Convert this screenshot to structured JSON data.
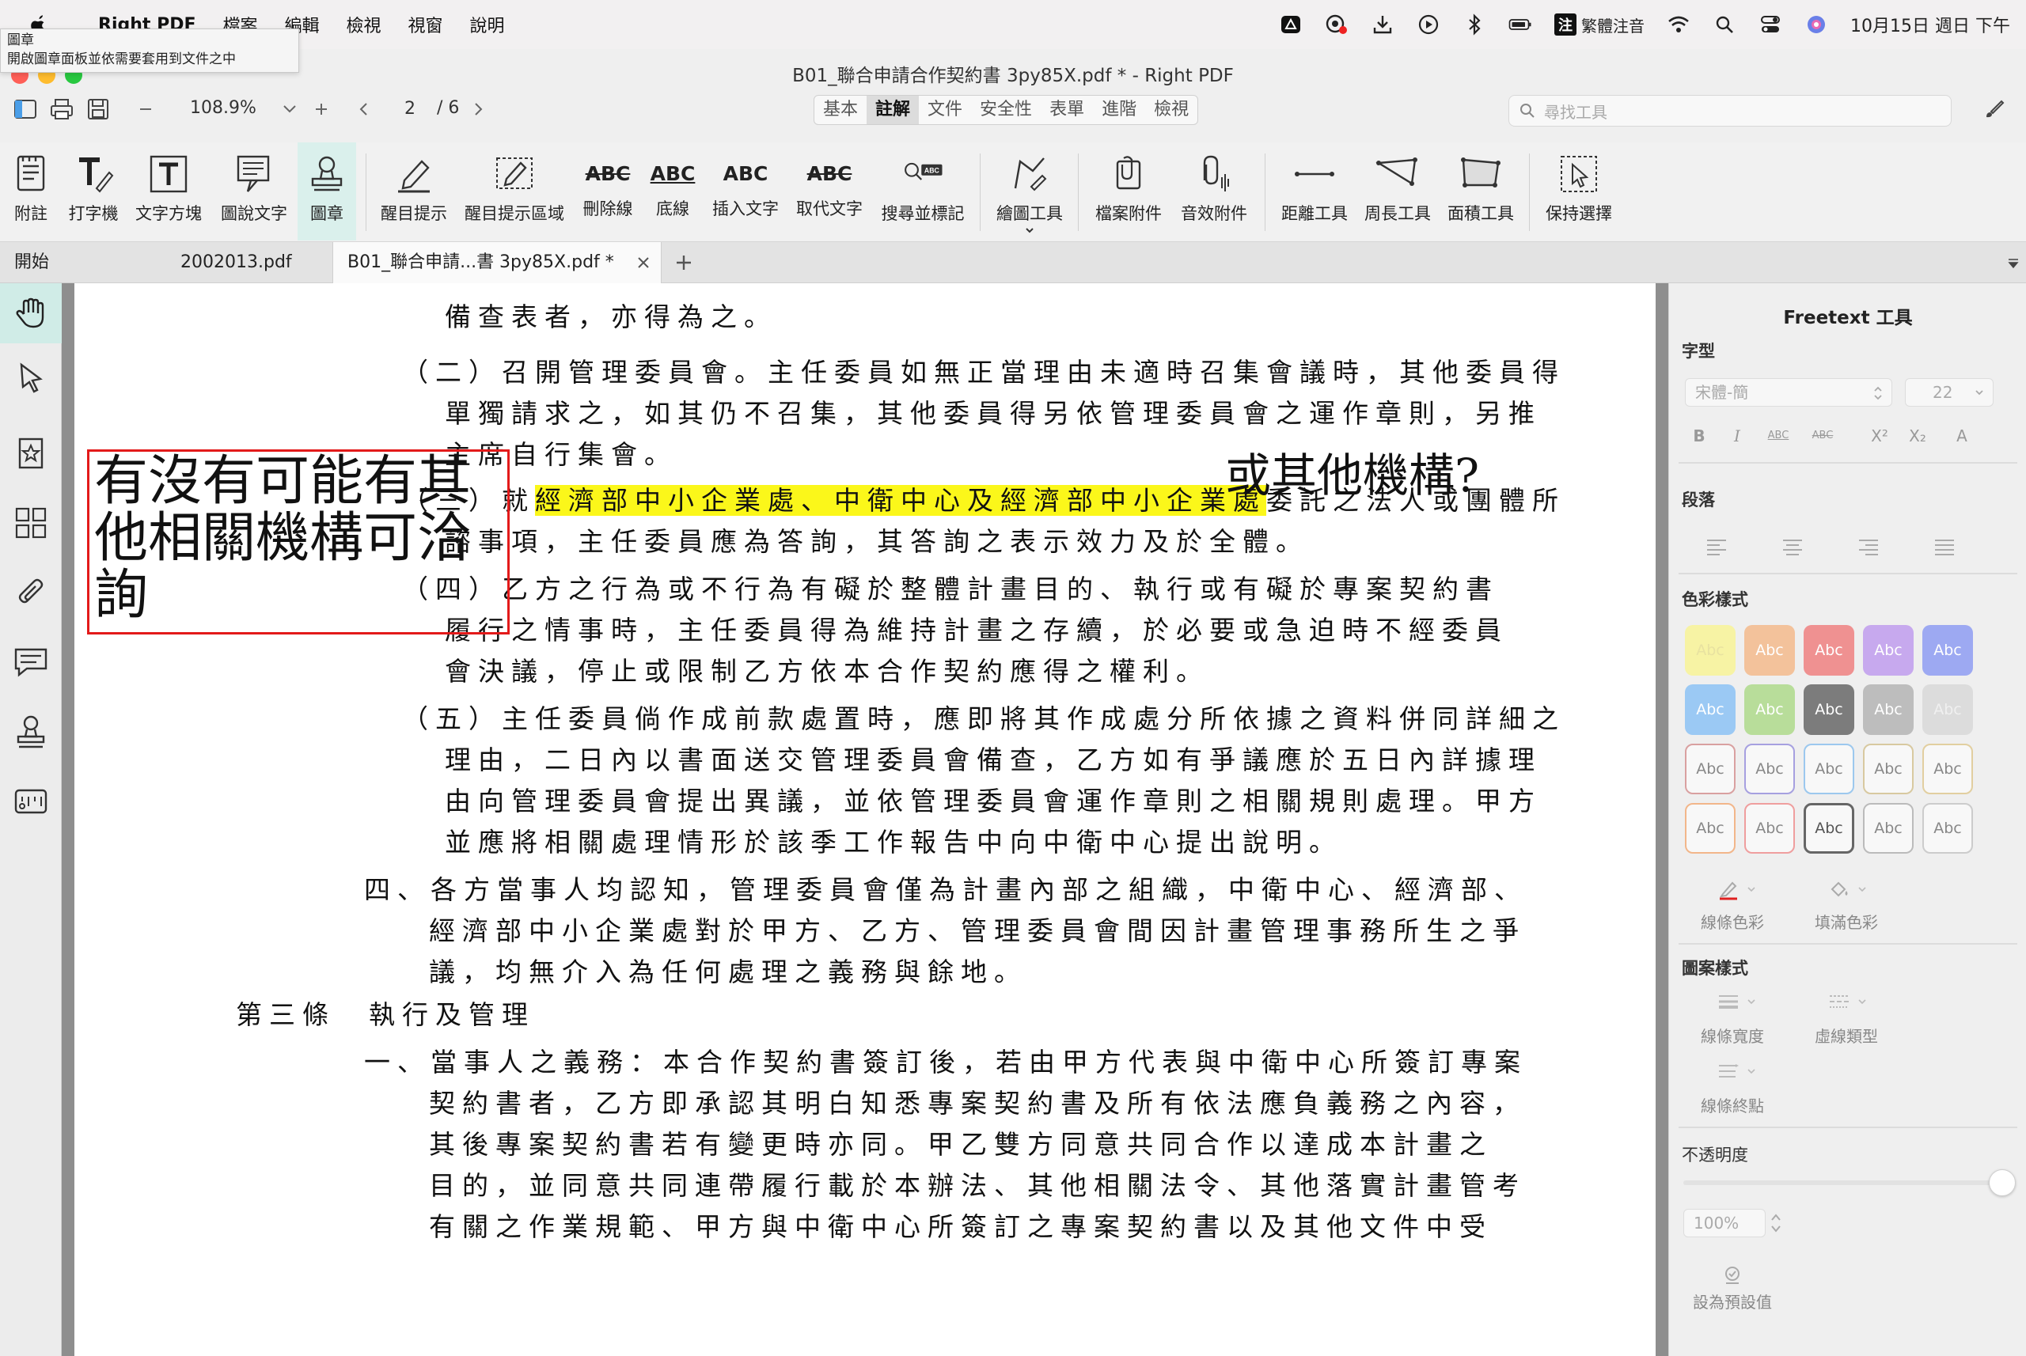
{
  "menubar": {
    "app_name": "Right PDF",
    "items": [
      "檔案",
      "編輯",
      "檢視",
      "視窗",
      "說明"
    ],
    "input_method": "注",
    "input_method_label": "繁體注音",
    "clock": "10月15日 週日 下午"
  },
  "tooltip": {
    "line1": "圖章",
    "line2": "開啟圖章面板並依需要套用到文件之中"
  },
  "window": {
    "title": "B01_聯合申請合作契約書 3py85X.pdf * - Right PDF",
    "zoom": "108.9%",
    "page_current": "2",
    "page_total": "/ 6",
    "mode_tabs": [
      "基本",
      "註解",
      "文件",
      "安全性",
      "表單",
      "進階",
      "檢視"
    ],
    "active_mode_tab": "註解",
    "search_placeholder": "尋找工具"
  },
  "ribbon": {
    "tools": [
      {
        "label": "附註",
        "icon": "note-icon"
      },
      {
        "label": "打字機",
        "icon": "typewriter-icon"
      },
      {
        "label": "文字方塊",
        "icon": "textbox-icon"
      },
      {
        "label": "圖說文字",
        "icon": "callout-icon"
      },
      {
        "label": "圖章",
        "icon": "stamp-icon",
        "active": true
      },
      {
        "label": "醒目提示",
        "icon": "highlight-icon"
      },
      {
        "label": "醒目提示區域",
        "icon": "highlight-area-icon"
      },
      {
        "label": "刪除線",
        "icon": "strikeout-icon",
        "abc": "ABC"
      },
      {
        "label": "底線",
        "icon": "underline-icon",
        "abc": "ABC"
      },
      {
        "label": "插入文字",
        "icon": "insert-text-icon",
        "abc": "ABC"
      },
      {
        "label": "取代文字",
        "icon": "replace-text-icon",
        "abc": "ABC"
      },
      {
        "label": "搜尋並標記",
        "icon": "search-mark-icon"
      },
      {
        "label": "繪圖工具",
        "icon": "draw-tool-icon"
      },
      {
        "label": "檔案附件",
        "icon": "file-attach-icon"
      },
      {
        "label": "音效附件",
        "icon": "sound-attach-icon"
      },
      {
        "label": "距離工具",
        "icon": "distance-tool-icon"
      },
      {
        "label": "周長工具",
        "icon": "perimeter-tool-icon"
      },
      {
        "label": "面積工具",
        "icon": "area-tool-icon"
      },
      {
        "label": "保持選擇",
        "icon": "keep-select-icon"
      }
    ]
  },
  "doc_tabs": {
    "home": "開始",
    "tabs": [
      "2002013.pdf",
      "B01_聯合申請...書 3py85X.pdf *"
    ],
    "active": "B01_聯合申請...書 3py85X.pdf *"
  },
  "document": {
    "lines": [
      "備查表者，亦得為之。",
      "（二）召開管理委員會。主任委員如無正當理由未適時召集會議時，其他委員得",
      "單獨請求之，如其仍不召集，其他委員得另依管理委員會之運作章則，另推",
      "主席自行集會。",
      "（三）就",
      "經濟部中小企業處、中衛中心及經濟部中小企業處",
      "委託之法人或團體所",
      "諮事項，主任委員應為答詢，其答詢之表示效力及於全體。",
      "（四）乙方之行為或不行為有礙於整體計畫目的、執行或有礙於專案契約書",
      "履行之情事時，主任委員得為維持計畫之存續，於必要或急迫時不經委員",
      "會決議，停止或限制乙方依本合作契約應得之權利。",
      "（五）主任委員倘作成前款處置時，應即將其作成處分所依據之資料併同詳細之",
      "理由，二日內以書面送交管理委員會備查，乙方如有爭議應於五日內詳據理",
      "由向管理委員會提出異議，並依管理委員會運作章則之相關規則處理。甲方",
      "並應將相關處理情形於該季工作報告中向中衛中心提出說明。",
      "四、各方當事人均認知，管理委員會僅為計畫內部之組織，中衛中心、經濟部、",
      "經濟部中小企業處對於甲方、乙方、管理委員會間因計畫管理事務所生之爭",
      "議，均無介入為任何處理之義務與餘地。",
      "第三條　執行及管理",
      "一、當事人之義務：本合作契約書簽訂後，若由甲方代表與中衛中心所簽訂專案",
      "契約書者，乙方即承認其明白知悉專案契約書及所有依法應負義務之內容，",
      "其後專案契約書若有變更時亦同。甲乙雙方同意共同合作以達成本計畫之",
      "目的，並同意共同連帶履行載於本辦法、其他相關法令、其他落實計畫管考",
      "有關之作業規範、甲方與中衛中心所簽訂之專案契約書以及其他文件中受"
    ],
    "textbox_annotation": "有沒有可能有其他相關機構可洽詢",
    "freetext_annotation": "或其他機構?",
    "highlight_color": "#fbf71a",
    "box_border_color": "#e31a1a"
  },
  "right_panel": {
    "title": "Freetext 工具",
    "font_section": "字型",
    "font_name": "宋體-簡",
    "font_size": "22",
    "format_buttons": [
      "B",
      "I",
      "ABC",
      "ABC",
      "X²",
      "X₂",
      "A"
    ],
    "paragraph_section": "段落",
    "color_style_section": "色彩樣式",
    "swatch_label": "Abc",
    "swatches": [
      {
        "bg": "#f7f3a4",
        "fg": "#e8e2a0",
        "border": "none"
      },
      {
        "bg": "#f3c29b",
        "fg": "#ffffff",
        "border": "none"
      },
      {
        "bg": "#ef9191",
        "fg": "#ffffff",
        "border": "none"
      },
      {
        "bg": "#c7a9ee",
        "fg": "#ffffff",
        "border": "none"
      },
      {
        "bg": "#9da9f2",
        "fg": "#ffffff",
        "border": "none"
      },
      {
        "bg": "#9bc9f4",
        "fg": "#ffffff",
        "border": "none"
      },
      {
        "bg": "#b8dd9a",
        "fg": "#ffffff",
        "border": "none"
      },
      {
        "bg": "#7c7c7c",
        "fg": "#ffffff",
        "border": "none"
      },
      {
        "bg": "#bdbdbd",
        "fg": "#ffffff",
        "border": "none"
      },
      {
        "bg": "#dcdcdc",
        "fg": "#f0f0f0",
        "border": "none"
      },
      {
        "bg": "#f8f8f8",
        "fg": "#888888",
        "border": "#d9a0a0"
      },
      {
        "bg": "#f8f8f8",
        "fg": "#888888",
        "border": "#a6a0e0"
      },
      {
        "bg": "#f8f8f8",
        "fg": "#888888",
        "border": "#9cc8ee"
      },
      {
        "bg": "#f8f8f8",
        "fg": "#888888",
        "border": "#d8c9a0"
      },
      {
        "bg": "#f8f8f8",
        "fg": "#888888",
        "border": "#e2cfa0"
      },
      {
        "bg": "#f8f8f8",
        "fg": "#888888",
        "border": "#f2b68a"
      },
      {
        "bg": "#f8f8f8",
        "fg": "#888888",
        "border": "#ef9e9e"
      },
      {
        "bg": "#f8f8f8",
        "fg": "#555555",
        "border": "#666666"
      },
      {
        "bg": "#f8f8f8",
        "fg": "#888888",
        "border": "#bbbbbb"
      },
      {
        "bg": "#f8f8f8",
        "fg": "#888888",
        "border": "#cccccc"
      }
    ],
    "line_color_label": "線條色彩",
    "fill_color_label": "填滿色彩",
    "pattern_section": "圖案樣式",
    "line_width_label": "線條寬度",
    "dash_type_label": "虛線類型",
    "line_end_label": "線條終點",
    "opacity_section": "不透明度",
    "opacity_value": "100%",
    "set_default_label": "設為預設值"
  }
}
